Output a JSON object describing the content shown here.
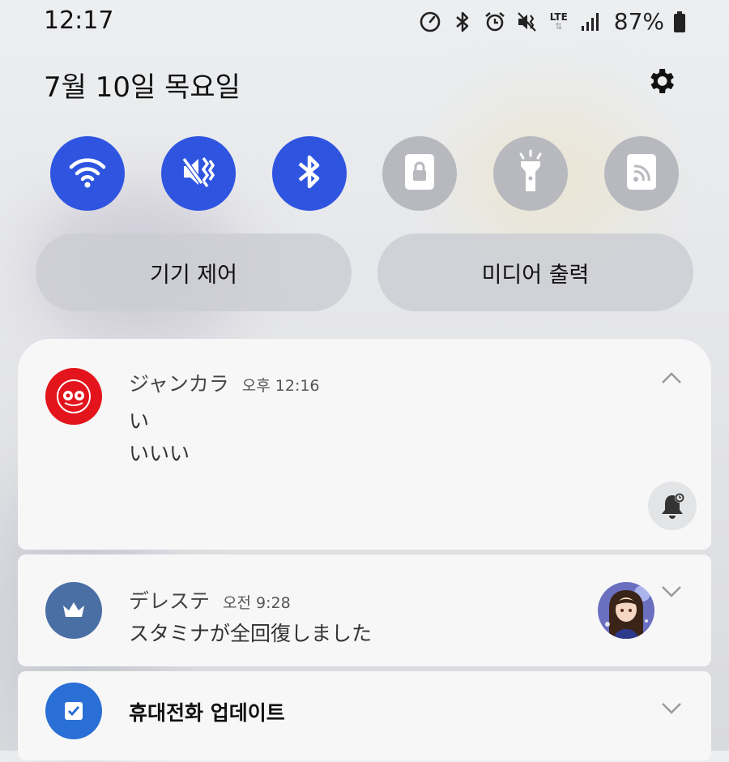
{
  "status_bar": {
    "time": "12:17",
    "icons": [
      "data-saver-icon",
      "bluetooth-icon",
      "alarm-icon",
      "vibrate-icon",
      "lte-icon",
      "signal-icon"
    ],
    "lte_label": "LTE",
    "battery_percent": "87%"
  },
  "header": {
    "date": "7월 10일 목요일",
    "settings_icon": "gear-icon"
  },
  "quick_settings": [
    {
      "name": "wifi",
      "icon": "wifi-icon",
      "state": "on"
    },
    {
      "name": "sound",
      "icon": "vibrate-icon",
      "state": "on"
    },
    {
      "name": "bluetooth",
      "icon": "bluetooth-icon",
      "state": "on"
    },
    {
      "name": "rotation-lock",
      "icon": "rotation-lock-icon",
      "state": "off"
    },
    {
      "name": "flashlight",
      "icon": "flashlight-icon",
      "state": "off"
    },
    {
      "name": "nfc",
      "icon": "nfc-icon",
      "state": "off"
    }
  ],
  "shortcuts": {
    "device_control": "기기 제어",
    "media_output": "미디어 출력"
  },
  "notifications": [
    {
      "app": "ジャンカラ",
      "time": "오후 12:16",
      "title": "い",
      "body": "いいい",
      "icon_color": "#e3141b"
    },
    {
      "app": "デレステ",
      "time": "오전 9:28",
      "body": "スタミナが全回復しました",
      "icon_color": "#4a6fa5"
    },
    {
      "app": "휴대전화 업데이트",
      "icon_color": "#2a6fd6"
    }
  ],
  "colors": {
    "accent": "#2f55e0",
    "tile_off": "#b8b9bf",
    "card_bg": "#f7f7f8"
  }
}
